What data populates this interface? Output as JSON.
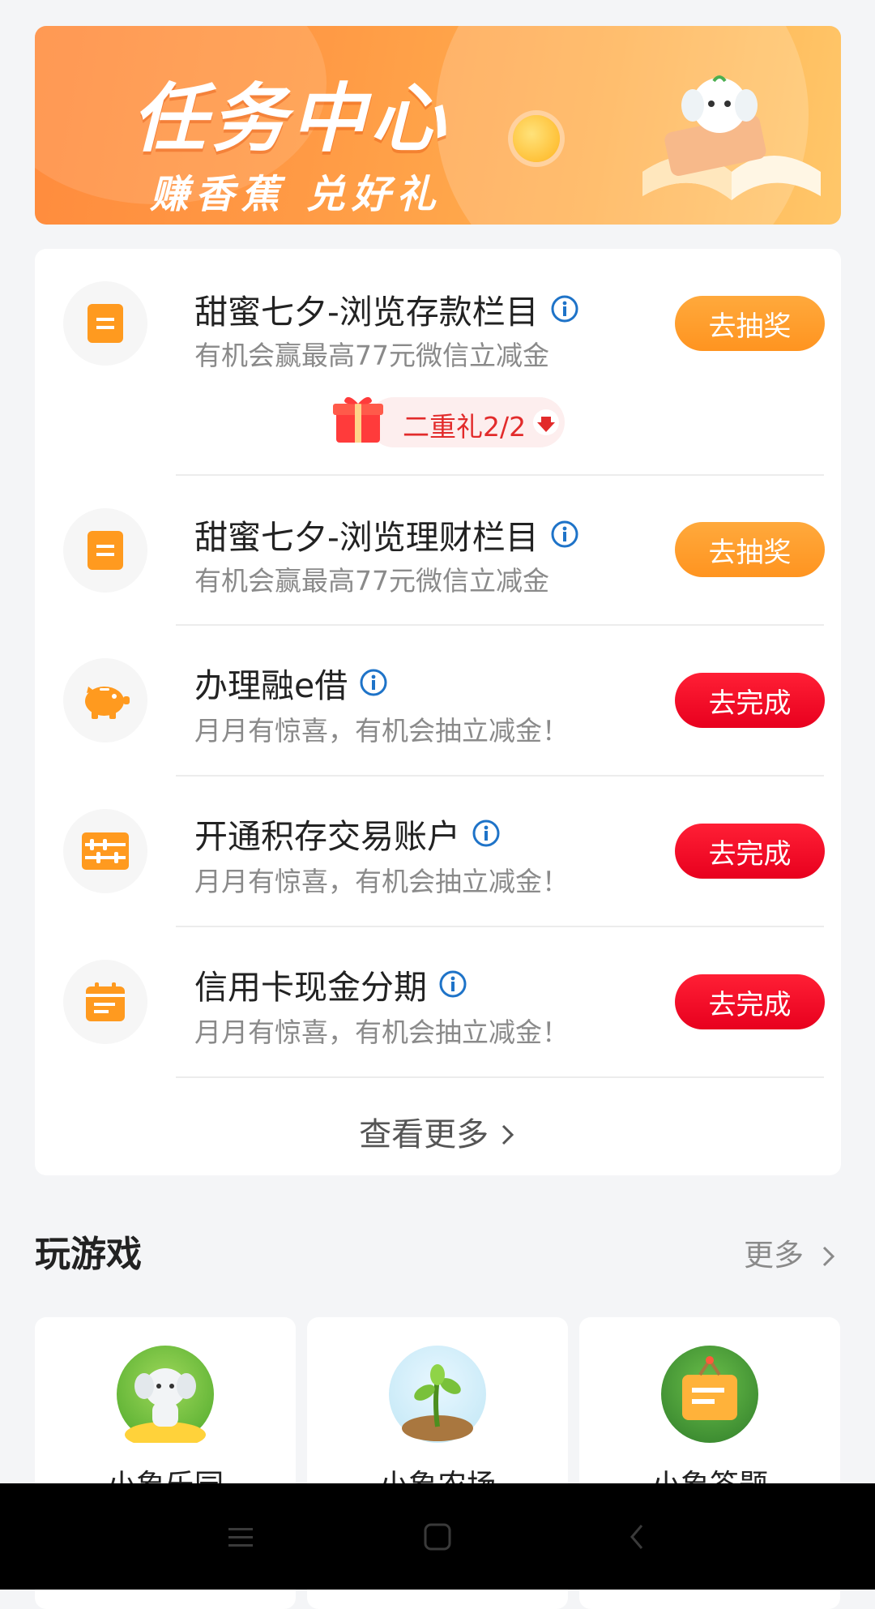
{
  "banner": {
    "title": "任务中心",
    "subtitle": "赚香蕉 兑好礼"
  },
  "tasks": [
    {
      "title": "甜蜜七夕-浏览存款栏目",
      "desc": "有机会赢最高77元微信立减金",
      "button": "去抽奖",
      "button_style": "orange",
      "icon": "document-icon",
      "gift_badge": "二重礼2/2"
    },
    {
      "title": "甜蜜七夕-浏览理财栏目",
      "desc": "有机会赢最高77元微信立减金",
      "button": "去抽奖",
      "button_style": "orange",
      "icon": "document-icon"
    },
    {
      "title": "办理融e借",
      "desc": "月月有惊喜，有机会抽立减金！",
      "button": "去完成",
      "button_style": "red",
      "icon": "piggy-bank-icon"
    },
    {
      "title": "开通积存交易账户",
      "desc": "月月有惊喜，有机会抽立减金！",
      "button": "去完成",
      "button_style": "red",
      "icon": "abacus-icon"
    },
    {
      "title": "信用卡现金分期",
      "desc": "月月有惊喜，有机会抽立减金！",
      "button": "去完成",
      "button_style": "red",
      "icon": "calendar-icon"
    }
  ],
  "see_more": "查看更多",
  "games_section": {
    "title": "玩游戏",
    "more": "更多",
    "games": [
      {
        "name": "小象乐园"
      },
      {
        "name": "小象农场"
      },
      {
        "name": "小象答题"
      }
    ]
  },
  "colors": {
    "orange_button": "#ff9420",
    "red_button": "#e8001e",
    "info_icon": "#1e73c8",
    "icon_orange": "#ff9a1f"
  }
}
